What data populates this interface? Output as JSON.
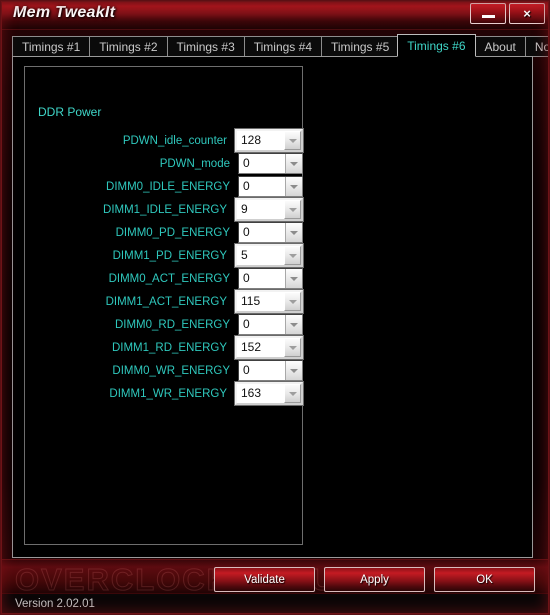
{
  "window": {
    "title": "Mem TweakIt",
    "minimize_label": "–",
    "close_label": "×"
  },
  "tabs": [
    {
      "label": "Timings #1",
      "active": false
    },
    {
      "label": "Timings #2",
      "active": false
    },
    {
      "label": "Timings #3",
      "active": false
    },
    {
      "label": "Timings #4",
      "active": false
    },
    {
      "label": "Timings #5",
      "active": false
    },
    {
      "label": "Timings #6",
      "active": true
    },
    {
      "label": "About",
      "active": false
    },
    {
      "label": "Notice",
      "active": false
    }
  ],
  "group": {
    "title": "DDR Power"
  },
  "fields": [
    {
      "label": "PDWN_idle_counter",
      "value": "128",
      "style": "alt"
    },
    {
      "label": "PDWN_mode",
      "value": "0",
      "style": "plain"
    },
    {
      "label": "DIMM0_IDLE_ENERGY",
      "value": "0",
      "style": "plain"
    },
    {
      "label": "DIMM1_IDLE_ENERGY",
      "value": "9",
      "style": "alt"
    },
    {
      "label": "DIMM0_PD_ENERGY",
      "value": "0",
      "style": "plain"
    },
    {
      "label": "DIMM1_PD_ENERGY",
      "value": "5",
      "style": "alt"
    },
    {
      "label": "DIMM0_ACT_ENERGY",
      "value": "0",
      "style": "plain"
    },
    {
      "label": "DIMM1_ACT_ENERGY",
      "value": "115",
      "style": "alt"
    },
    {
      "label": "DIMM0_RD_ENERGY",
      "value": "0",
      "style": "plain"
    },
    {
      "label": "DIMM1_RD_ENERGY",
      "value": "152",
      "style": "alt"
    },
    {
      "label": "DIMM0_WR_ENERGY",
      "value": "0",
      "style": "plain"
    },
    {
      "label": "DIMM1_WR_ENERGY",
      "value": "163",
      "style": "alt"
    }
  ],
  "buttons": {
    "validate": "Validate",
    "apply": "Apply",
    "ok": "OK"
  },
  "watermark": "OVERCLOCKERS.UA",
  "status": {
    "version": "Version 2.02.01"
  },
  "colors": {
    "accent_red": "#a8161d",
    "label_teal": "#2fc8bd",
    "active_tab_text": "#3fd6c8"
  }
}
